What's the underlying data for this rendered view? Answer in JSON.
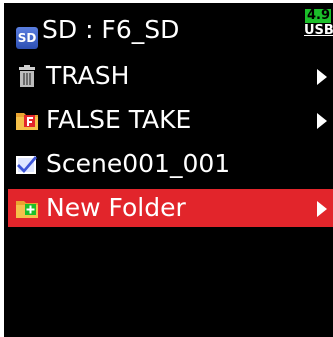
{
  "header": {
    "sd_badge": "SD",
    "title": "SD : F6_SD",
    "battery_level": "4.9",
    "power_source": "USB"
  },
  "items": [
    {
      "label": "TRASH",
      "icon": "trash-icon",
      "has_submenu": true,
      "selected": false
    },
    {
      "label": "FALSE TAKE",
      "icon": "false-take-folder-icon",
      "has_submenu": true,
      "selected": false
    },
    {
      "label": "Scene001_001",
      "icon": "checked-folder-icon",
      "has_submenu": false,
      "selected": false
    },
    {
      "label": "New Folder",
      "icon": "new-folder-icon",
      "has_submenu": true,
      "selected": true
    }
  ],
  "colors": {
    "background": "#000000",
    "selection": "#e2252b",
    "battery": "#1bbf2a"
  }
}
